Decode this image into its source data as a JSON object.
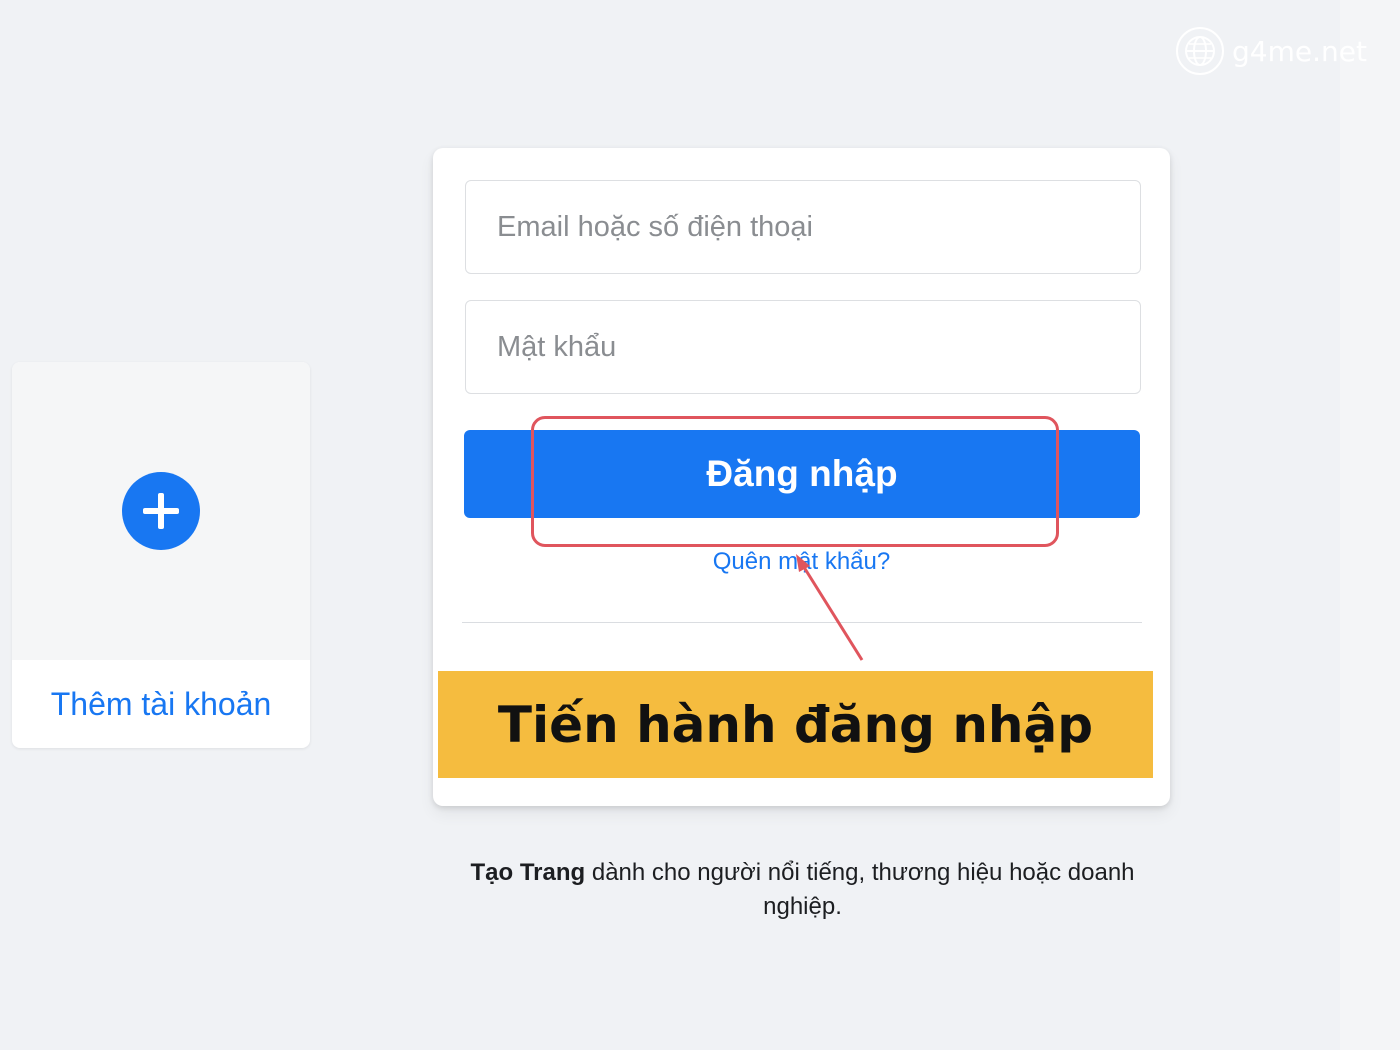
{
  "watermark": {
    "text": "g4me.net",
    "icon": "globe-icon"
  },
  "add_account": {
    "label": "Thêm tài khoản",
    "icon": "plus-icon"
  },
  "login": {
    "email_placeholder": "Email hoặc số điện thoại",
    "password_placeholder": "Mật khẩu",
    "login_button": "Đăng nhập",
    "forgot_link": "Quên mật khẩu?"
  },
  "annotation": {
    "callout_text": "Tiến hành đăng nhập"
  },
  "footer": {
    "create_page_bold": "Tạo Trang",
    "create_page_rest": " dành cho người nổi tiếng, thương hiệu hoặc doanh nghiệp."
  },
  "colors": {
    "brand_blue": "#1877f2",
    "highlight_red": "#e0555d",
    "callout_yellow": "#f5bc3f",
    "page_bg": "#f0f2f5"
  }
}
